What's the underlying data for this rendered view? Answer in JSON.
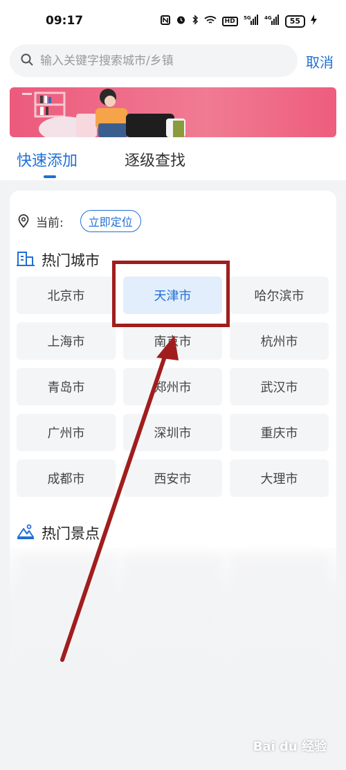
{
  "statusbar": {
    "time": "09:17",
    "battery": "55",
    "icons": [
      "nfc-icon",
      "alarm-icon",
      "bluetooth-icon",
      "wifi-icon",
      "hd-icon",
      "signal-5g-icon",
      "signal-4g-icon",
      "charging-icon"
    ],
    "labels": {
      "hd": "HD",
      "fiveg": "5G",
      "fourg": "4G"
    }
  },
  "search": {
    "placeholder": "输入关键字搜索城市/乡镇",
    "cancel_label": "取消"
  },
  "tabs": [
    {
      "label": "快速添加",
      "active": true
    },
    {
      "label": "逐级查找",
      "active": false
    }
  ],
  "location": {
    "label": "当前:",
    "locate_button": "立即定位"
  },
  "hot_cities": {
    "title": "热门城市",
    "cities": [
      "北京市",
      "天津市",
      "哈尔滨市",
      "上海市",
      "南京市",
      "杭州市",
      "青岛市",
      "郑州市",
      "武汉市",
      "广州市",
      "深圳市",
      "重庆市",
      "成都市",
      "西安市",
      "大理市"
    ],
    "selected": "天津市"
  },
  "hot_scenic": {
    "title": "热门景点"
  },
  "watermark": "Bai du 经验",
  "colors": {
    "accent": "#1f6fd6",
    "annotation": "#a11d1d",
    "banner": "#ec5a7c"
  }
}
